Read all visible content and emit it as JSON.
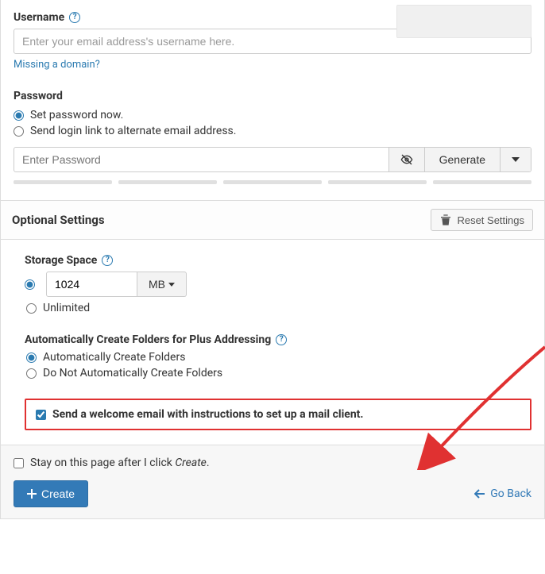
{
  "username": {
    "label": "Username",
    "placeholder": "Enter your email address's username here.",
    "missing_domain_link": "Missing a domain?"
  },
  "password": {
    "label": "Password",
    "option_set_now": "Set password now.",
    "option_send_link": "Send login link to alternate email address.",
    "placeholder": "Enter Password",
    "generate_label": "Generate"
  },
  "optional": {
    "heading": "Optional Settings",
    "reset_label": "Reset Settings",
    "storage": {
      "label": "Storage Space",
      "value": "1024",
      "unit": "MB",
      "unlimited_label": "Unlimited"
    },
    "plus_addressing": {
      "label": "Automatically Create Folders for Plus Addressing",
      "option_yes": "Automatically Create Folders",
      "option_no": "Do Not Automatically Create Folders"
    },
    "welcome_email": "Send a welcome email with instructions to set up a mail client."
  },
  "footer": {
    "stay_prefix": "Stay on this page after I click ",
    "stay_em": "Create",
    "stay_suffix": ".",
    "create_label": "Create",
    "go_back_label": "Go Back"
  }
}
